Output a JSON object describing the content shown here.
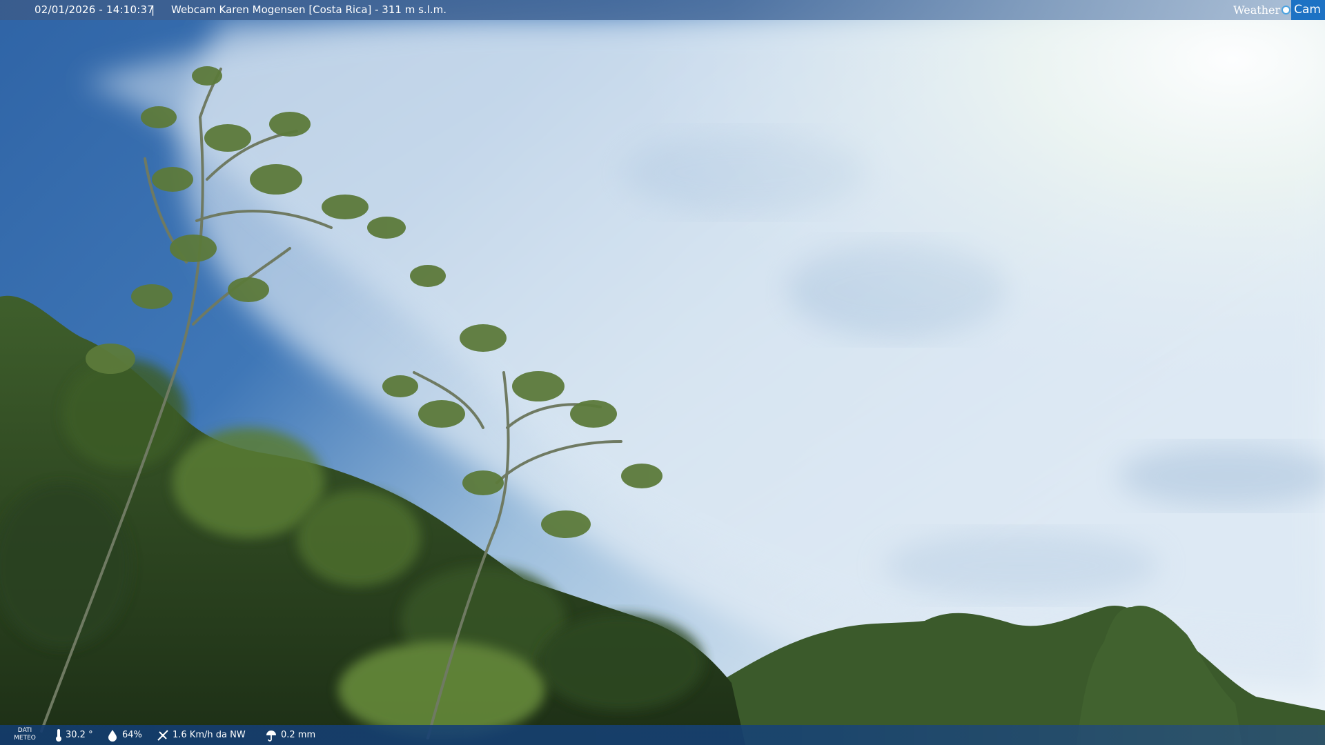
{
  "header": {
    "datetime": "02/01/2026 - 14:10:37",
    "separator": "|",
    "title": "Webcam Karen Mogensen [Costa Rica]  - 311 m s.l.m.",
    "logo_weather": "Weather",
    "logo_cam": "Cam"
  },
  "weather": {
    "label_line1": "DATI",
    "label_line2": "METEO",
    "temperature": "30.2 °",
    "humidity": "64%",
    "wind": "1.6 Km/h da NW",
    "rain": "0.2 mm"
  },
  "icons": {
    "temperature": "thermometer-icon",
    "humidity": "humidity-icon",
    "wind": "wind-icon",
    "rain": "rain-icon"
  },
  "colors": {
    "sky_deep": "#2a5d9c",
    "sky_cloud": "#d9e6f2",
    "foliage": "#2e4a22",
    "logo_blue": "#1d72c4"
  }
}
